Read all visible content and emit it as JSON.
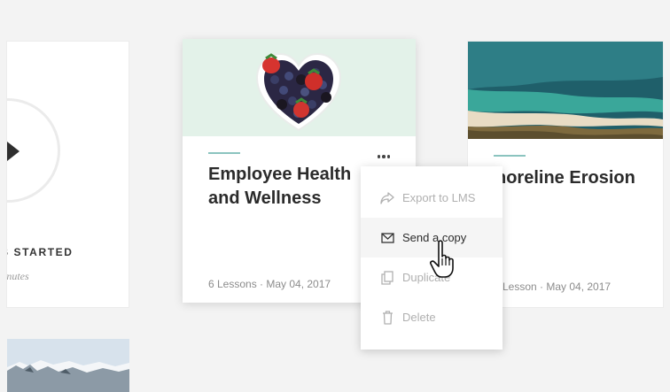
{
  "left_card": {
    "label": "S STARTED",
    "duration": "inutes"
  },
  "center_card": {
    "title": "Employee Health and Wellness",
    "meta": "6 Lessons · May 04, 2017"
  },
  "right_card": {
    "title": "horeline Erosion",
    "meta": "Lesson · May 04, 2017"
  },
  "menu": {
    "items": [
      {
        "label": "Export to LMS",
        "icon": "share-arrow-icon",
        "state": "disabled"
      },
      {
        "label": "Send a copy",
        "icon": "envelope-icon",
        "state": "hovered"
      },
      {
        "label": "Duplicate",
        "icon": "copy-icon",
        "state": "disabled"
      },
      {
        "label": "Delete",
        "icon": "trash-icon",
        "state": "disabled"
      }
    ]
  },
  "colors": {
    "accent": "#8bc4bf",
    "background": "#f3f3f3",
    "text": "#2b2b2b",
    "disabled_text": "#b0b0b0"
  }
}
